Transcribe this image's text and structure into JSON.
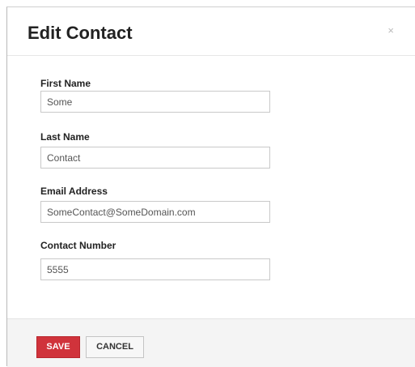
{
  "dialog": {
    "title": "Edit Contact",
    "close_glyph": "×"
  },
  "form": {
    "first_name": {
      "label": "First Name",
      "value": "Some"
    },
    "last_name": {
      "label": "Last Name",
      "value": "Contact"
    },
    "email": {
      "label": "Email Address",
      "value": "SomeContact@SomeDomain.com"
    },
    "contact_number": {
      "label": "Contact Number",
      "value": "5555"
    }
  },
  "footer": {
    "save_label": "SAVE",
    "cancel_label": "CANCEL"
  },
  "colors": {
    "save_button": "#d0333b",
    "footer_background": "#f4f4f4"
  }
}
